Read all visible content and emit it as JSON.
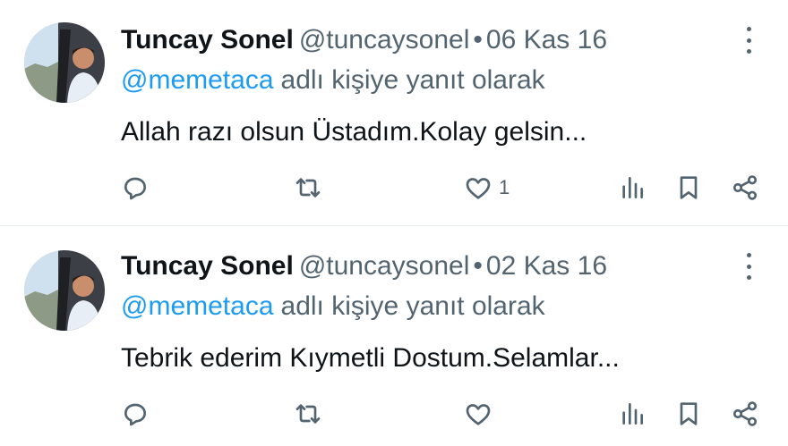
{
  "tweets": [
    {
      "author_name": "Tuncay Sonel",
      "handle": "@tuncaysonel",
      "separator": "•",
      "date": "06 Kas 16",
      "mention": "@memetaca",
      "reply_suffix": "adlı kişiye yanıt olarak",
      "text": "Allah razı olsun Üstadım.Kolay gelsin...",
      "like_count": "1"
    },
    {
      "author_name": "Tuncay Sonel",
      "handle": "@tuncaysonel",
      "separator": "•",
      "date": "02 Kas 16",
      "mention": "@memetaca",
      "reply_suffix": "adlı kişiye yanıt olarak",
      "text": "Tebrik ederim Kıymetli Dostum.Selamlar...",
      "like_count": ""
    }
  ],
  "colors": {
    "accent": "#1d9bf0",
    "text": "#0f1419",
    "muted": "#536471",
    "divider": "#e6ecf0"
  },
  "icons": [
    "avatar",
    "more-icon",
    "reply-icon",
    "retweet-icon",
    "like-icon",
    "views-icon",
    "bookmark-icon",
    "share-icon"
  ]
}
